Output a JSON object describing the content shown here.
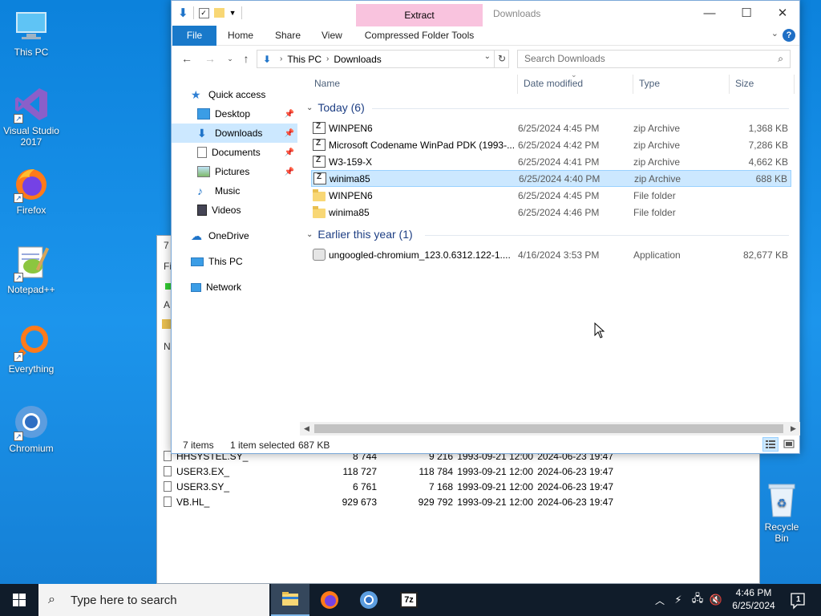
{
  "desktop": {
    "icons": [
      {
        "label": "This PC"
      },
      {
        "label": "Visual Studio 2017"
      },
      {
        "label": "Firefox"
      },
      {
        "label": "Notepad++"
      },
      {
        "label": "Everything"
      },
      {
        "label": "Chromium"
      }
    ],
    "recycle_bin": "Recycle Bin"
  },
  "bg_window": {
    "side_letters": [
      "7",
      "Fil",
      "A",
      "N"
    ],
    "rows": [
      {
        "name": "HHSYSTEL.SY_",
        "size": "8 744",
        "packed": "9 216",
        "modified": "1993-09-21 12:00",
        "created": "2024-06-23 19:47"
      },
      {
        "name": "USER3.EX_",
        "size": "118 727",
        "packed": "118 784",
        "modified": "1993-09-21 12:00",
        "created": "2024-06-23 19:47"
      },
      {
        "name": "USER3.SY_",
        "size": "6 761",
        "packed": "7 168",
        "modified": "1993-09-21 12:00",
        "created": "2024-06-23 19:47"
      },
      {
        "name": "VB.HL_",
        "size": "929 673",
        "packed": "929 792",
        "modified": "1993-09-21 12:00",
        "created": "2024-06-23 19:47"
      }
    ]
  },
  "explorer": {
    "title": "Downloads",
    "context_tab": "Extract",
    "context_subtab": "Compressed Folder Tools",
    "tabs": [
      "File",
      "Home",
      "Share",
      "View"
    ],
    "help": "?",
    "breadcrumb": [
      "This PC",
      "Downloads"
    ],
    "search_placeholder": "Search Downloads",
    "nav": {
      "quick_access": "Quick access",
      "items": [
        "Desktop",
        "Downloads",
        "Documents",
        "Pictures",
        "Music",
        "Videos"
      ],
      "onedrive": "OneDrive",
      "this_pc": "This PC",
      "network": "Network"
    },
    "columns": [
      "Name",
      "Date modified",
      "Type",
      "Size"
    ],
    "groups": [
      {
        "title": "Today (6)",
        "files": [
          {
            "name": "WINPEN6",
            "date": "6/25/2024 4:45 PM",
            "type": "zip Archive",
            "size": "1,368 KB"
          },
          {
            "name": "Microsoft Codename WinPad PDK (1993-...",
            "date": "6/25/2024 4:42 PM",
            "type": "zip Archive",
            "size": "7,286 KB"
          },
          {
            "name": "W3-159-X",
            "date": "6/25/2024 4:41 PM",
            "type": "zip Archive",
            "size": "4,662 KB"
          },
          {
            "name": "winima85",
            "date": "6/25/2024 4:40 PM",
            "type": "zip Archive",
            "size": "688 KB"
          },
          {
            "name": "WINPEN6",
            "date": "6/25/2024 4:45 PM",
            "type": "File folder",
            "size": ""
          },
          {
            "name": "winima85",
            "date": "6/25/2024 4:46 PM",
            "type": "File folder",
            "size": ""
          }
        ]
      },
      {
        "title": "Earlier this year (1)",
        "files": [
          {
            "name": "ungoogled-chromium_123.0.6312.122-1....",
            "date": "4/16/2024 3:53 PM",
            "type": "Application",
            "size": "82,677 KB"
          }
        ]
      }
    ],
    "status": {
      "count": "7 items",
      "selected": "1 item selected",
      "sel_size": "687 KB"
    }
  },
  "taskbar": {
    "search_placeholder": "Type here to search",
    "time": "4:46 PM",
    "date": "6/25/2024",
    "notifications": "1",
    "sevenzip_label": "7z"
  },
  "colors": {
    "accent": "#1979ca",
    "selection": "#cce8ff",
    "context_tab": "#f9c3de"
  }
}
